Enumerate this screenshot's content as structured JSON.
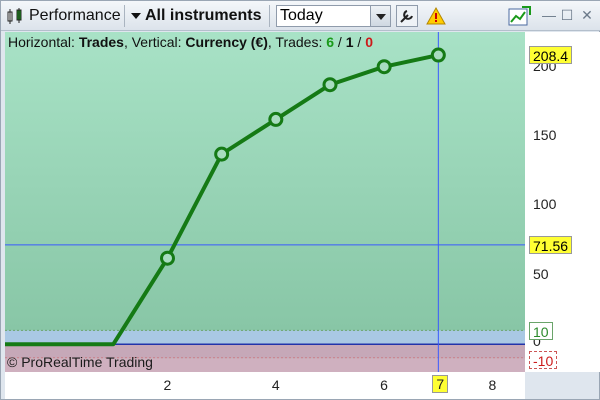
{
  "toolbar": {
    "panel_name": "Performance",
    "instrument_label": "All instruments",
    "period_value": "Today"
  },
  "chart_info": {
    "horizontal_label": "Horizontal: ",
    "horizontal_value": "Trades",
    "vertical_label": ", Vertical: ",
    "vertical_value": "Currency (€)",
    "trades_label": ", Trades: ",
    "trades_win": "6",
    "trades_sep1": " / ",
    "trades_neutral": "1",
    "trades_sep2": " / ",
    "trades_loss": "0"
  },
  "copyright": "© ProRealTime Trading",
  "colors": {
    "line": "#157a15",
    "win": "#1a9a1a",
    "loss": "#cc1a1a",
    "crosshair": "#3a5aff",
    "tag_yellow": "#ffff33"
  },
  "axis": {
    "y_ticks": [
      "50",
      "100",
      "150",
      "200"
    ],
    "x_ticks": [
      "2",
      "4",
      "6",
      "8"
    ],
    "tag_top": "208.4",
    "tag_cross": "71.56",
    "tag_band_high": "10",
    "tag_band_low": "-10",
    "tag_x_cross": "7",
    "zero_tick": "0"
  },
  "chart_data": {
    "type": "line",
    "x": [
      0,
      1,
      2,
      3,
      4,
      5,
      6,
      7
    ],
    "values": [
      0,
      0,
      62,
      137,
      162,
      187,
      200,
      208.4
    ],
    "ylim": [
      -20,
      225
    ],
    "xlim": [
      -1,
      8.6
    ],
    "band": [
      -10,
      10
    ],
    "crosshair": {
      "x": 7,
      "y": 71.56
    }
  }
}
